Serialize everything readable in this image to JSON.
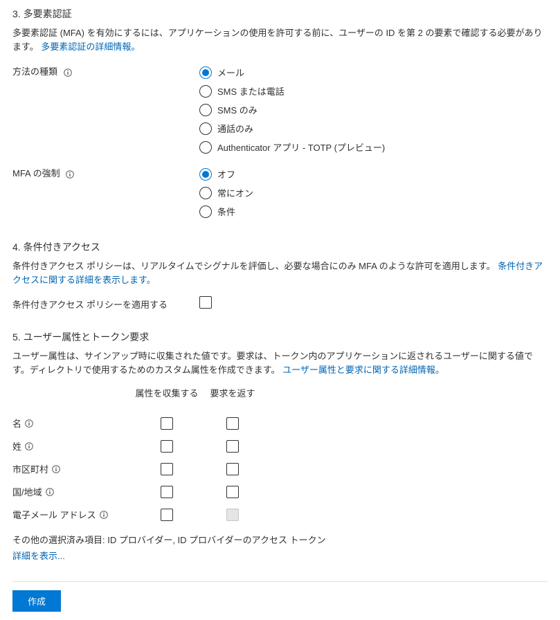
{
  "mfa": {
    "title": "3. 多要素認証",
    "desc": "多要素認証 (MFA) を有効にするには、アプリケーションの使用を許可する前に、ユーザーの ID を第 2 の要素で確認する必要があります。",
    "link": "多要素認証の詳細情報。",
    "method_label": "方法の種類",
    "methods": [
      "メール",
      "SMS または電話",
      "SMS のみ",
      "通話のみ",
      "Authenticator アプリ - TOTP (プレビュー)"
    ],
    "method_selected": 0,
    "enforce_label": "MFA の強制",
    "enforce_options": [
      "オフ",
      "常にオン",
      "条件"
    ],
    "enforce_selected": 0
  },
  "ca": {
    "title": "4. 条件付きアクセス",
    "desc": "条件付きアクセス ポリシーは、リアルタイムでシグナルを評価し、必要な場合にのみ MFA のような許可を適用します。",
    "link": "条件付きアクセスに関する詳細を表示します。",
    "checkbox_label": "条件付きアクセス ポリシーを適用する"
  },
  "attrs": {
    "title": "5. ユーザー属性とトークン要求",
    "desc": "ユーザー属性は、サインアップ時に収集された値です。要求は、トークン内のアプリケーションに返されるユーザーに関する値です。ディレクトリで使用するためのカスタム属性を作成できます。",
    "link": "ユーザー属性と要求に関する詳細情報。",
    "col_collect": "属性を収集する",
    "col_return": "要求を返す",
    "rows": [
      {
        "label": "名",
        "info": true,
        "return_disabled": false
      },
      {
        "label": "姓",
        "info": true,
        "return_disabled": false
      },
      {
        "label": "市区町村",
        "info": true,
        "return_disabled": false
      },
      {
        "label": "国/地域",
        "info": true,
        "return_disabled": false
      },
      {
        "label": "電子メール アドレス",
        "info": true,
        "return_disabled": true
      }
    ],
    "other_prefix": "その他の選択済み項目: ",
    "other_items": "ID プロバイダー, ID プロバイダーのアクセス トークン",
    "show_more": "詳細を表示..."
  },
  "footer": {
    "create": "作成"
  }
}
